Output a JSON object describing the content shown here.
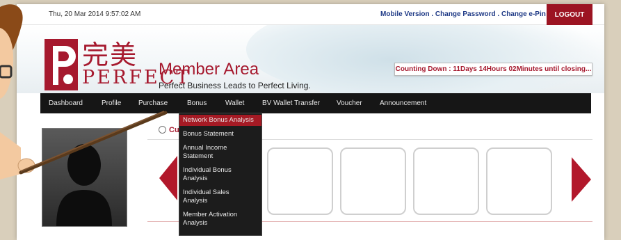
{
  "topbar": {
    "datetime": "Thu, 20 Mar 2014  9:57:02 AM",
    "links": {
      "mobile": "Mobile Version",
      "sep1": " . ",
      "change_password": "Change Password",
      "sep2": " . ",
      "change_epin": "Change e-Pin"
    },
    "logout_label": "LOGOUT"
  },
  "header": {
    "logo_cn": "完美",
    "logo_en": "PERFECT",
    "title": "Member Area",
    "tagline": "Perfect Business Leads to Perfect Living.",
    "countdown": "Counting Down : 11Days 14Hours 02Minutes until closing..."
  },
  "nav": {
    "items": [
      "Dashboard",
      "Profile",
      "Purchase",
      "Bonus",
      "Wallet",
      "BV Wallet Transfer",
      "Voucher",
      "Announcement"
    ]
  },
  "dropdown": {
    "items": [
      "Network Bonus Analysis",
      "Bonus Statement",
      "Annual Income Statement",
      "Individual Bonus Analysis",
      "Individual Sales Analysis",
      "Member Activation Analysis"
    ]
  },
  "content": {
    "section_title": "Cu"
  },
  "colors": {
    "brand_red": "#a6192e",
    "nav_bg": "#161616",
    "link_blue": "#1f3a86"
  }
}
